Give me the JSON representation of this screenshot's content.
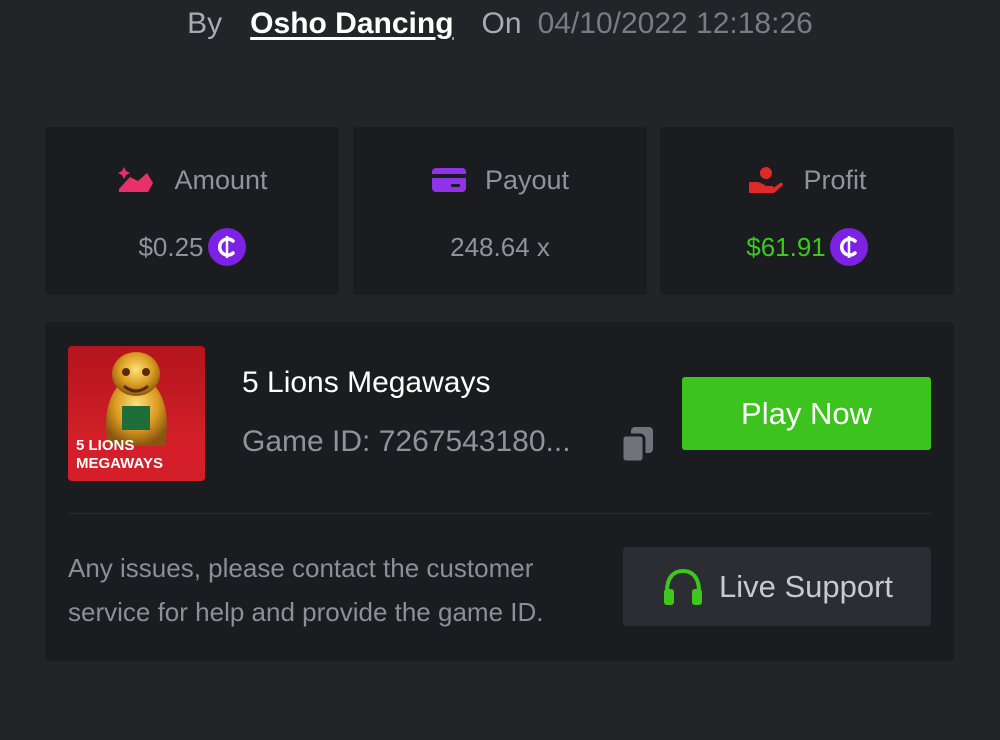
{
  "byline": {
    "by_label": "By",
    "username": "Osho Dancing",
    "on_label": "On",
    "datetime": "04/10/2022 12:18:26"
  },
  "stats": {
    "amount": {
      "label": "Amount",
      "value": "$0.25",
      "icon": "wager-icon",
      "icon_color": "#e8306a"
    },
    "payout": {
      "label": "Payout",
      "value": "248.64 x",
      "icon": "card-icon",
      "icon_color": "#8f33e8"
    },
    "profit": {
      "label": "Profit",
      "value": "$61.91",
      "icon": "hand-heart-icon",
      "icon_color": "#e02a2a",
      "value_color": "#3ec81e"
    }
  },
  "coin_symbol": "₵",
  "game": {
    "title": "5 Lions Megaways",
    "id_text": "Game ID: 7267543180...",
    "thumb_line1": "5 LIONS",
    "thumb_line2": "MEGAWAYS",
    "play_label": "Play Now"
  },
  "support": {
    "help_text": "Any issues, please contact the customer service for help and provide the game ID.",
    "button_label": "Live Support"
  },
  "colors": {
    "background": "#232428",
    "card": "#1b1c20",
    "play_button": "#3cc31e",
    "coin": "#7b22e3"
  }
}
